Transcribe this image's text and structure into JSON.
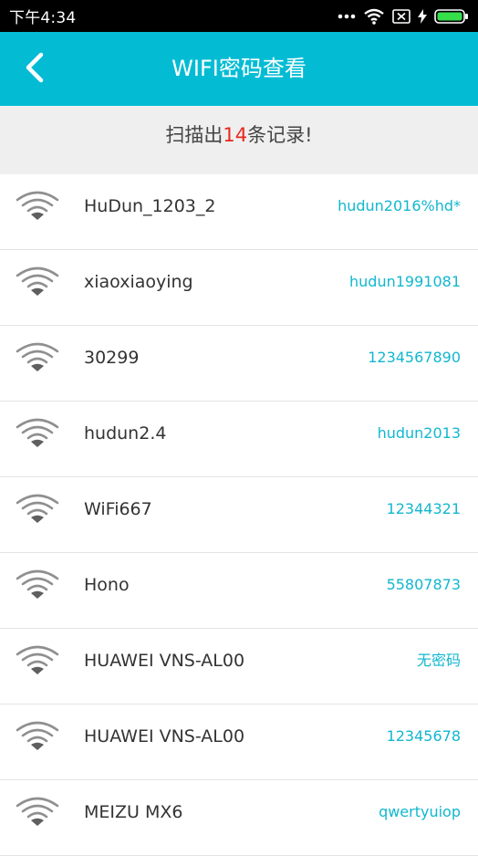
{
  "status_bar": {
    "time": "下午4:34",
    "icons": [
      "more-dots-icon",
      "wifi-signal-icon",
      "sim-x-icon",
      "charging-bolt-icon",
      "battery-icon"
    ]
  },
  "header": {
    "title": "WIFI密码查看",
    "back_icon": "chevron-left-icon"
  },
  "summary": {
    "prefix": "扫描出",
    "count": "14",
    "suffix": "条记录!"
  },
  "colors": {
    "accent": "#03bcd4",
    "password_text": "#12b7cf",
    "count_highlight": "#e8281e",
    "summary_bg": "#efefef"
  },
  "wifi_list": [
    {
      "ssid": "HuDun_1203_2",
      "password": "hudun2016%hd*"
    },
    {
      "ssid": "xiaoxiaoying",
      "password": "hudun1991081"
    },
    {
      "ssid": "30299",
      "password": "1234567890"
    },
    {
      "ssid": "hudun2.4",
      "password": "hudun2013"
    },
    {
      "ssid": "WiFi667",
      "password": "12344321"
    },
    {
      "ssid": "Hono",
      "password": "55807873"
    },
    {
      "ssid": "HUAWEI VNS-AL00",
      "password": "无密码"
    },
    {
      "ssid": "HUAWEI VNS-AL00",
      "password": "12345678"
    },
    {
      "ssid": "MEIZU MX6",
      "password": "qwertyuiop"
    }
  ]
}
